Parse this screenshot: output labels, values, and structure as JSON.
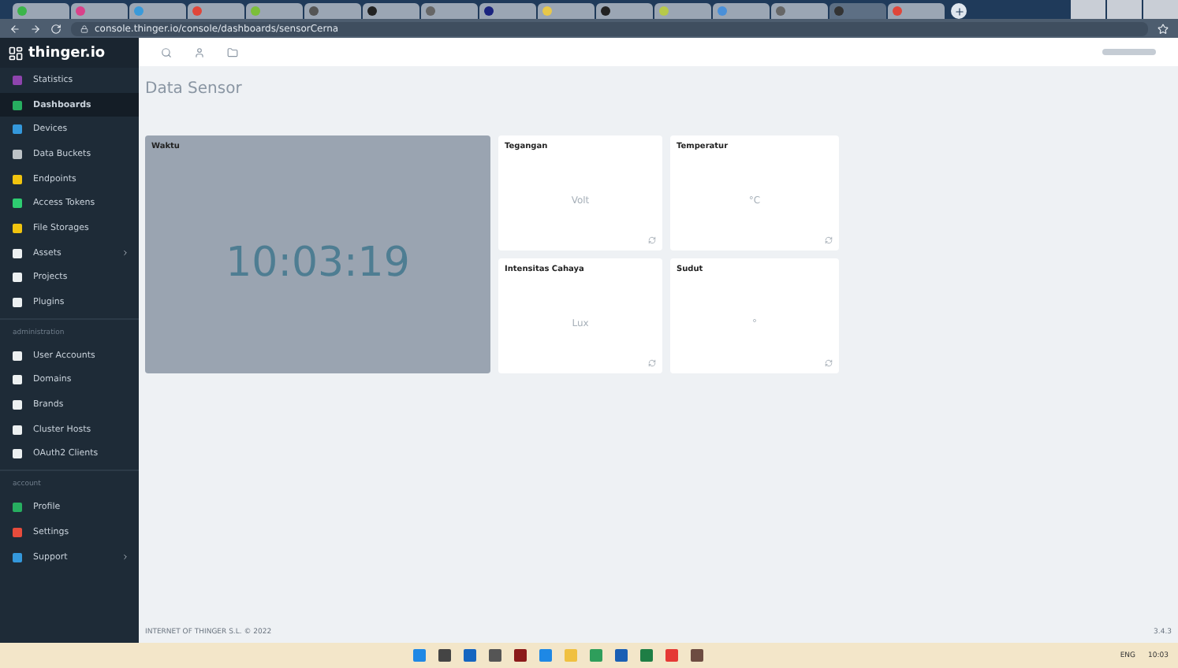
{
  "browser": {
    "tabs": [
      {
        "color": "#3bb54a",
        "selected": false
      },
      {
        "color": "#d9418a",
        "selected": false
      },
      {
        "color": "#3a9ad9",
        "selected": false
      },
      {
        "color": "#e0463a",
        "selected": false
      },
      {
        "color": "#7bbf3a",
        "selected": false
      },
      {
        "color": "#555555",
        "selected": false
      },
      {
        "color": "#222222",
        "selected": false
      },
      {
        "color": "#666666",
        "selected": false
      },
      {
        "color": "#1a237e",
        "selected": false
      },
      {
        "color": "#e8c84a",
        "selected": false
      },
      {
        "color": "#222222",
        "selected": false
      },
      {
        "color": "#b7c94a",
        "selected": false
      },
      {
        "color": "#4a90d9",
        "selected": false
      },
      {
        "color": "#666666",
        "selected": false
      },
      {
        "color": "#333333",
        "selected": true
      },
      {
        "color": "#e0463a",
        "selected": false
      }
    ],
    "url": "console.thinger.io/console/dashboards/sensorCerna"
  },
  "brand": "thinger.io",
  "sidebar": {
    "sections": [
      {
        "items": [
          {
            "label": "Statistics",
            "color": "#8e44ad",
            "selected": false,
            "expandable": false
          },
          {
            "label": "Dashboards",
            "color": "#27ae60",
            "selected": true,
            "expandable": false
          },
          {
            "label": "Devices",
            "color": "#3498db",
            "selected": false,
            "expandable": false
          },
          {
            "label": "Data Buckets",
            "color": "#bdc3c7",
            "selected": false,
            "expandable": false
          },
          {
            "label": "Endpoints",
            "color": "#f1c40f",
            "selected": false,
            "expandable": false
          },
          {
            "label": "Access Tokens",
            "color": "#2ecc71",
            "selected": false,
            "expandable": false
          },
          {
            "label": "File Storages",
            "color": "#f1c40f",
            "selected": false,
            "expandable": false
          },
          {
            "label": "Assets",
            "color": "#ecf0f1",
            "selected": false,
            "expandable": true
          },
          {
            "label": "Projects",
            "color": "#ecf0f1",
            "selected": false,
            "expandable": false
          },
          {
            "label": "Plugins",
            "color": "#ecf0f1",
            "selected": false,
            "expandable": false
          }
        ]
      },
      {
        "title": "administration",
        "items": [
          {
            "label": "User Accounts",
            "color": "#ecf0f1",
            "selected": false,
            "expandable": false
          },
          {
            "label": "Domains",
            "color": "#ecf0f1",
            "selected": false,
            "expandable": false
          },
          {
            "label": "Brands",
            "color": "#ecf0f1",
            "selected": false,
            "expandable": false
          },
          {
            "label": "Cluster Hosts",
            "color": "#ecf0f1",
            "selected": false,
            "expandable": false
          },
          {
            "label": "OAuth2 Clients",
            "color": "#ecf0f1",
            "selected": false,
            "expandable": false
          }
        ]
      },
      {
        "title": "account",
        "items": [
          {
            "label": "Profile",
            "color": "#27ae60",
            "selected": false,
            "expandable": false
          },
          {
            "label": "Settings",
            "color": "#e74c3c",
            "selected": false,
            "expandable": false
          },
          {
            "label": "Support",
            "color": "#3498db",
            "selected": false,
            "expandable": true
          }
        ]
      }
    ]
  },
  "page": {
    "title": "Data Sensor"
  },
  "widgets": [
    {
      "kind": "clock",
      "title": "Waktu",
      "value": "10:03:19"
    },
    {
      "kind": "value",
      "title": "Tegangan",
      "unit": "Volt"
    },
    {
      "kind": "value",
      "title": "Temperatur",
      "unit": "°C"
    },
    {
      "kind": "value",
      "title": "Intensitas Cahaya",
      "unit": "Lux"
    },
    {
      "kind": "value",
      "title": "Sudut",
      "unit": "°"
    }
  ],
  "footer": {
    "copyright": "INTERNET OF THINGER S.L. © 2022",
    "version": "3.4.3"
  },
  "taskbar": {
    "apps": [
      {
        "color": "#1e88e5"
      },
      {
        "color": "#444444"
      },
      {
        "color": "#1565c0"
      },
      {
        "color": "#555555"
      },
      {
        "color": "#8b1a1a"
      },
      {
        "color": "#1e88e5"
      },
      {
        "color": "#f0c040"
      },
      {
        "color": "#2e9e5b"
      },
      {
        "color": "#1a5fb4"
      },
      {
        "color": "#1e7e45"
      },
      {
        "color": "#e53935"
      },
      {
        "color": "#6d4c41"
      }
    ],
    "language": "ENG",
    "time": "10:03"
  }
}
